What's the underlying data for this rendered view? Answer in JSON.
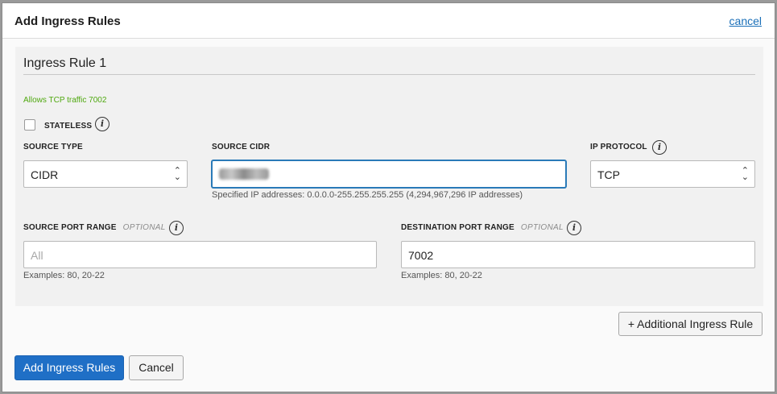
{
  "modal": {
    "title": "Add Ingress Rules",
    "cancel_link": "cancel"
  },
  "rule": {
    "title": "Ingress Rule 1",
    "description": "Allows TCP traffic 7002",
    "stateless": {
      "label": "STATELESS",
      "checked": false
    },
    "source_type": {
      "label": "SOURCE TYPE",
      "value": "CIDR"
    },
    "source_cidr": {
      "label": "SOURCE CIDR",
      "value": "",
      "helper": "Specified IP addresses: 0.0.0.0-255.255.255.255 (4,294,967,296 IP addresses)"
    },
    "ip_protocol": {
      "label": "IP PROTOCOL",
      "value": "TCP"
    },
    "source_port_range": {
      "label": "SOURCE PORT RANGE",
      "optional": "OPTIONAL",
      "placeholder": "All",
      "value": "",
      "helper": "Examples: 80, 20-22"
    },
    "destination_port_range": {
      "label": "DESTINATION PORT RANGE",
      "optional": "OPTIONAL",
      "value": "7002",
      "helper": "Examples: 80, 20-22"
    }
  },
  "buttons": {
    "additional_rule": "+ Additional Ingress Rule",
    "submit": "Add Ingress Rules",
    "cancel": "Cancel"
  },
  "icons": {
    "info": "info-icon",
    "select_arrows": "chevron-up-down-icon"
  },
  "colors": {
    "primary": "#1f6fc6",
    "link": "#1a6fb8",
    "description": "#4fa80f"
  }
}
